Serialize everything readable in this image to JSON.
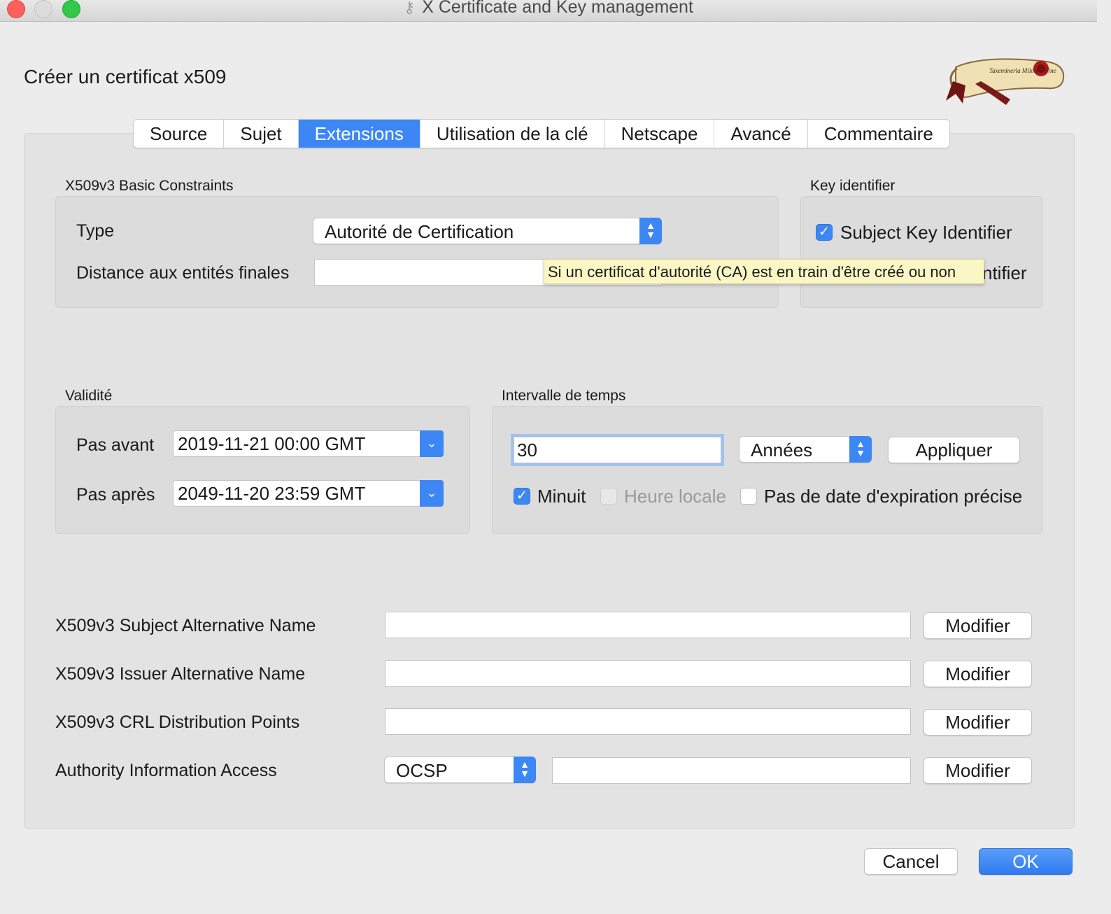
{
  "window": {
    "title": "X Certificate and Key management"
  },
  "dialog": {
    "title": "Créer un certificat x509"
  },
  "tabs": [
    {
      "label": "Source"
    },
    {
      "label": "Sujet"
    },
    {
      "label": "Extensions",
      "active": true
    },
    {
      "label": "Utilisation de la clé"
    },
    {
      "label": "Netscape"
    },
    {
      "label": "Avancé"
    },
    {
      "label": "Commentaire"
    }
  ],
  "basic_constraints": {
    "title": "X509v3 Basic Constraints",
    "type_label": "Type",
    "type_value": "Autorité de Certification",
    "pathlen_label": "Distance aux entités finales",
    "pathlen_value": ""
  },
  "key_identifier": {
    "title": "Key identifier",
    "subject_label": "Subject Key Identifier",
    "subject_checked": true,
    "partial_text": "ntifier"
  },
  "tooltip": {
    "text": "Si un certificat d'autorité (CA) est en train d'être créé ou non"
  },
  "validity": {
    "title": "Validité",
    "not_before_label": "Pas avant",
    "not_before_value": "2019-11-21 00:00 GMT",
    "not_after_label": "Pas après",
    "not_after_value": "2049-11-20 23:59 GMT"
  },
  "time_range": {
    "title": "Intervalle de temps",
    "amount": "30",
    "unit": "Années",
    "apply_label": "Appliquer",
    "midnight_label": "Minuit",
    "midnight_checked": true,
    "local_time_label": "Heure locale",
    "local_time_checked": false,
    "no_expiry_label": "Pas de date d'expiration précise",
    "no_expiry_checked": false
  },
  "extensions": {
    "san_label": "X509v3 Subject Alternative Name",
    "san_value": "",
    "ian_label": "X509v3 Issuer Alternative Name",
    "ian_value": "",
    "crl_label": "X509v3 CRL Distribution Points",
    "crl_value": "",
    "aia_label": "Authority Information Access",
    "aia_type": "OCSP",
    "aia_value": "",
    "modify_label": "Modifier"
  },
  "footer": {
    "cancel_label": "Cancel",
    "ok_label": "OK"
  },
  "colors": {
    "accent": "#3d87f5",
    "tooltip_bg": "#fbf7c4"
  },
  "logo": {
    "text": "Taxeminerla Milonne Fine"
  }
}
